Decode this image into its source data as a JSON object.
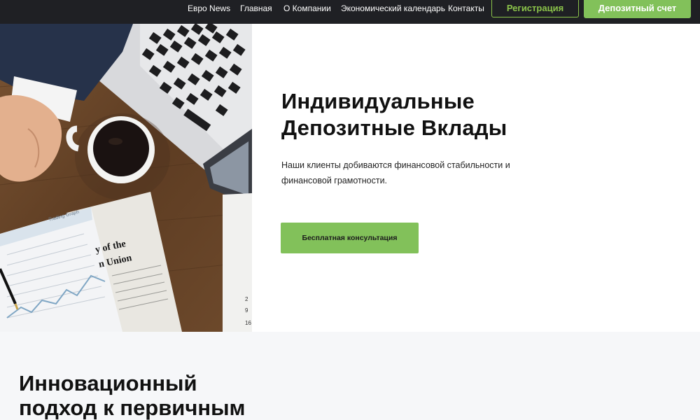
{
  "nav": {
    "links": [
      {
        "label": "Евро News"
      },
      {
        "label": "Главная"
      },
      {
        "label": "О Компании"
      },
      {
        "label": "Экономический календарь"
      },
      {
        "label": "Контакты"
      }
    ],
    "register_label": "Регистрация",
    "deposit_label": "Депозитный счет",
    "background": "#1f2024",
    "accent": "#82c15a"
  },
  "hero": {
    "title_line1": "Индивидуальные",
    "title_line2": "Депозитные Вклады",
    "text_line1": "Наши клиенты добиваются финансовой стабильности и",
    "text_line2": "финансовой грамотности.",
    "button_label": "Бесплатная консультация",
    "photo": {
      "newspaper_heading": "Trading Graph",
      "newspaper_text_1": "y of the",
      "newspaper_text_2": "n Union"
    }
  },
  "section2": {
    "title_line1": "Инновационный",
    "title_line2": "подход к первичным"
  }
}
